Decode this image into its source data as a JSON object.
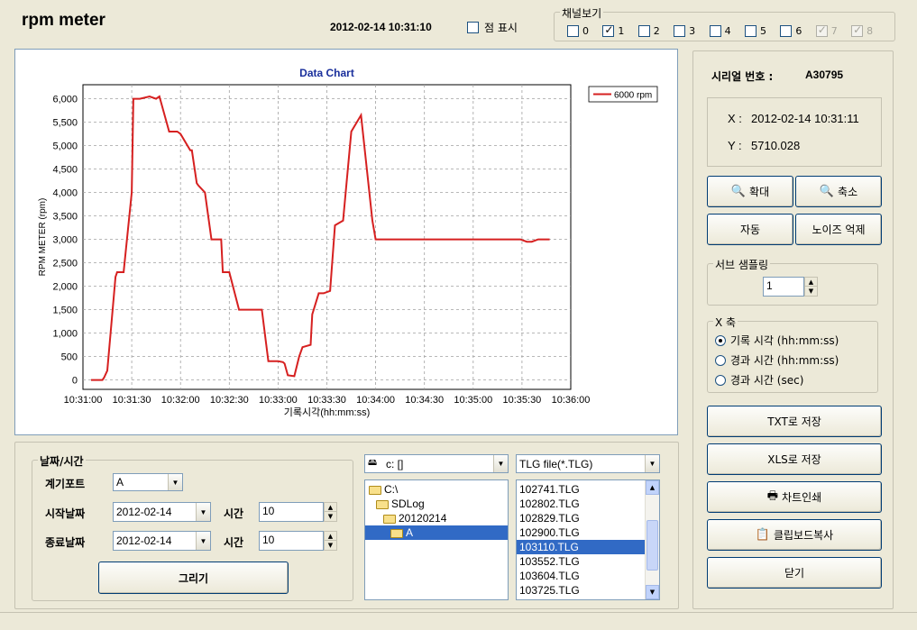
{
  "app_title": "rpm meter",
  "datetime": "2012-02-14 10:31:10",
  "show_points": {
    "label": "점 표시",
    "checked": false
  },
  "channels": {
    "title": "채널보기",
    "items": [
      {
        "label": "0",
        "checked": false,
        "disabled": false
      },
      {
        "label": "1",
        "checked": true,
        "disabled": false
      },
      {
        "label": "2",
        "checked": false,
        "disabled": false
      },
      {
        "label": "3",
        "checked": false,
        "disabled": false
      },
      {
        "label": "4",
        "checked": false,
        "disabled": false
      },
      {
        "label": "5",
        "checked": false,
        "disabled": false
      },
      {
        "label": "6",
        "checked": false,
        "disabled": false
      },
      {
        "label": "7",
        "checked": true,
        "disabled": true
      },
      {
        "label": "8",
        "checked": true,
        "disabled": true
      }
    ]
  },
  "chart_data": {
    "type": "line",
    "title": "Data Chart",
    "xlabel": "기록시각(hh:mm:ss)",
    "ylabel": "RPM METER (rpm)",
    "ylim": [
      -200,
      6300
    ],
    "y_ticks": [
      0,
      500,
      1000,
      1500,
      2000,
      2500,
      3000,
      3500,
      4000,
      4500,
      5000,
      5500,
      6000
    ],
    "y_tick_labels": [
      "0",
      "500",
      "1,000",
      "1,500",
      "2,000",
      "2,500",
      "3,000",
      "3,500",
      "4,000",
      "4,500",
      "5,000",
      "5,500",
      "6,000"
    ],
    "x_tick_labels": [
      "10:31:00",
      "10:31:30",
      "10:32:00",
      "10:32:30",
      "10:33:00",
      "10:33:30",
      "10:34:00",
      "10:34:30",
      "10:35:00",
      "10:35:30",
      "10:36:00"
    ],
    "xlim": [
      "10:31:00",
      "10:36:00"
    ],
    "grid": true,
    "legend_position": "top-right",
    "series": [
      {
        "name": "6000 rpm",
        "color": "#d62020",
        "x": [
          "10:31:05",
          "10:31:12",
          "10:31:13",
          "10:31:15",
          "10:31:20",
          "10:31:21",
          "10:31:25",
          "10:31:30",
          "10:31:31",
          "10:31:35",
          "10:31:41",
          "10:31:45",
          "10:31:47",
          "10:31:53",
          "10:31:58",
          "10:32:00",
          "10:32:06",
          "10:32:07",
          "10:32:10",
          "10:32:11",
          "10:32:15",
          "10:32:19",
          "10:32:20",
          "10:32:21",
          "10:32:25",
          "10:32:26",
          "10:32:30",
          "10:32:36",
          "10:32:38",
          "10:32:46",
          "10:32:50",
          "10:32:54",
          "10:32:56",
          "10:32:58",
          "10:33:00",
          "10:33:03",
          "10:33:04",
          "10:33:06",
          "10:33:10",
          "10:33:13",
          "10:33:15",
          "10:33:20",
          "10:33:21",
          "10:33:25",
          "10:33:28",
          "10:33:32",
          "10:33:35",
          "10:33:40",
          "10:33:45",
          "10:33:51",
          "10:33:58",
          "10:34:00",
          "10:34:30",
          "10:35:00",
          "10:35:29",
          "10:35:33",
          "10:35:36",
          "10:35:40",
          "10:35:47"
        ],
        "y": [
          0,
          0,
          50,
          200,
          2200,
          2300,
          2300,
          4000,
          6000,
          6000,
          6050,
          6000,
          6050,
          5300,
          5300,
          5250,
          4900,
          4900,
          4200,
          4150,
          4000,
          3000,
          3000,
          3000,
          3000,
          2300,
          2300,
          1500,
          1500,
          1500,
          1500,
          400,
          400,
          400,
          400,
          380,
          350,
          100,
          80,
          500,
          700,
          750,
          1400,
          1850,
          1850,
          1900,
          3300,
          3400,
          5300,
          5650,
          3400,
          3000,
          3000,
          3000,
          3000,
          2950,
          2950,
          3000,
          3000
        ]
      }
    ]
  },
  "right_panel": {
    "serial_label": "시리얼 번호 :",
    "serial_value": "A30795",
    "x_label": "X :",
    "x_value": "2012-02-14 10:31:11",
    "y_label": "Y :",
    "y_value": "5710.028",
    "zoom_in": "확대",
    "zoom_out": "축소",
    "auto": "자동",
    "noise": "노이즈 억제",
    "sub_sampling_title": "서브 샘플링",
    "sub_sampling_value": "1",
    "x_axis_title": "X 축",
    "x_axis_options": [
      {
        "label": "기록 시각 (hh:mm:ss)",
        "selected": true
      },
      {
        "label": "경과 시간 (hh:mm:ss)",
        "selected": false
      },
      {
        "label": "경과 시간 (sec)",
        "selected": false
      }
    ],
    "save_txt": "TXT로 저장",
    "save_xls": "XLS로 저장",
    "print_chart": "차트인쇄",
    "clipboard": "클립보드복사",
    "close": "닫기"
  },
  "datetime_panel": {
    "title": "날짜/시간",
    "port_label": "계기포트",
    "port_value": "A",
    "start_label": "시작날짜",
    "start_date": "2012-02-14",
    "start_time_label": "시간",
    "start_time": "10",
    "end_label": "종료날짜",
    "end_date": "2012-02-14",
    "end_time_label": "시간",
    "end_time": "10",
    "draw_button": "그리기"
  },
  "file_browser": {
    "drive": "c: []",
    "folders": [
      "C:\\",
      "SDLog",
      "20120214",
      "A"
    ],
    "selected_folder": "A",
    "filter": "TLG file(*.TLG)",
    "files": [
      "102741.TLG",
      "102802.TLG",
      "102829.TLG",
      "102900.TLG",
      "103110.TLG",
      "103552.TLG",
      "103604.TLG",
      "103725.TLG"
    ],
    "selected_file": "103110.TLG"
  }
}
